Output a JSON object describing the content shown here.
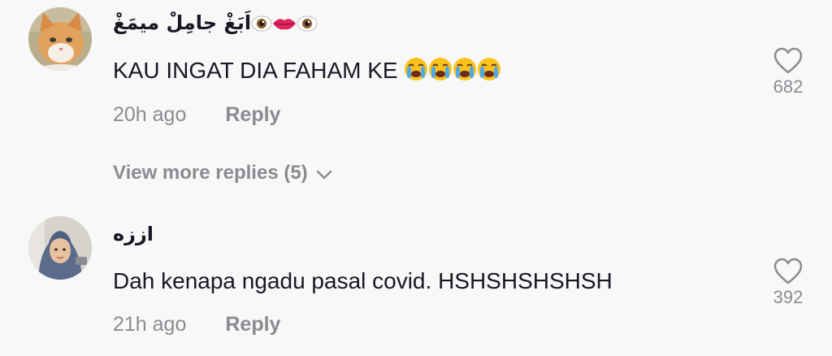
{
  "comments": [
    {
      "username": "اَبَغْ جامِلْ ميمَغْ",
      "username_emoji": [
        "eye-icon",
        "lips-icon",
        "eye-icon"
      ],
      "text": "KAU INGAT DIA FAHAM KE",
      "text_emoji": [
        "loudly-crying-face-icon",
        "loudly-crying-face-icon",
        "loudly-crying-face-icon",
        "loudly-crying-face-icon"
      ],
      "time": "20h ago",
      "reply_label": "Reply",
      "likes": "682",
      "avatar": "cat-avatar"
    },
    {
      "username": "اززه",
      "text": "Dah kenapa ngadu pasal covid. HSHSHSHSHSH",
      "time": "21h ago",
      "reply_label": "Reply",
      "likes": "392",
      "avatar": "person-avatar"
    }
  ],
  "view_more_replies": "View more replies (5)",
  "colors": {
    "background": "#f8f8f8",
    "text": "#161823",
    "muted": "#8a8b91"
  }
}
